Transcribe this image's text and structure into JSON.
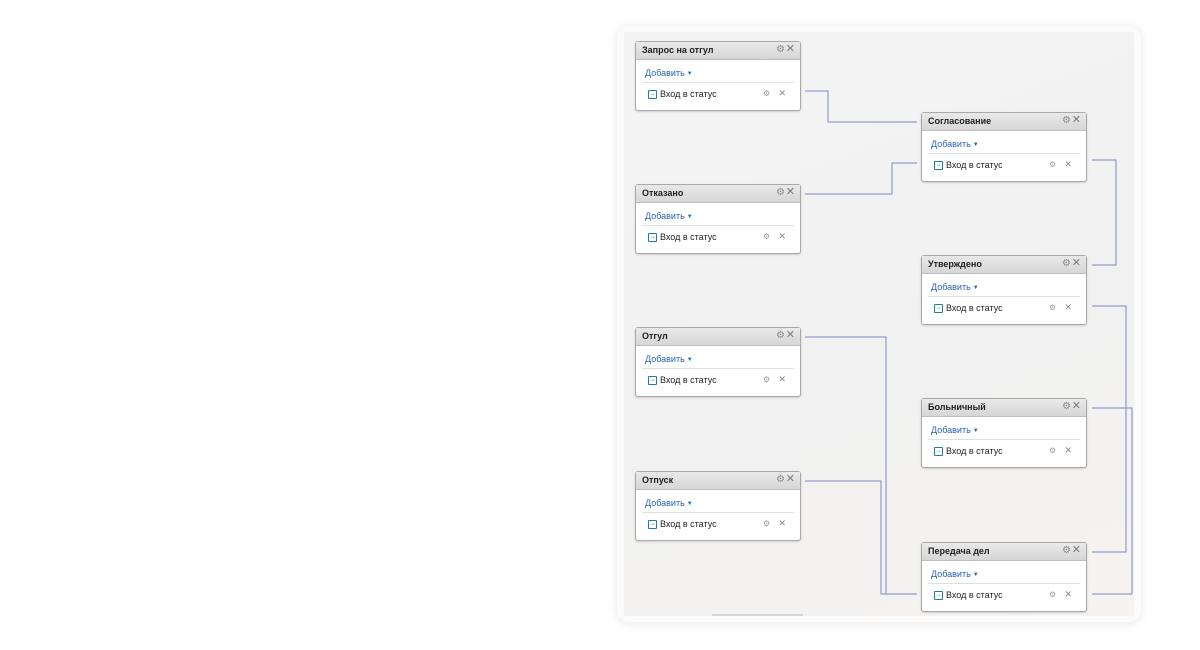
{
  "colors": {
    "connector": "#7c87c4",
    "link": "#2a64b0",
    "row_icon": "#1f7ea0"
  },
  "icons": {
    "settings": "gear-icon",
    "close": "close-icon",
    "row": "enter-status-icon",
    "caret": "caret-down-icon"
  },
  "nodes": [
    {
      "title": "Запрос на отгул",
      "add_label": "Добавить",
      "row_label": "Вход в статус"
    },
    {
      "title": "Отказано",
      "add_label": "Добавить",
      "row_label": "Вход в статус"
    },
    {
      "title": "Отгул",
      "add_label": "Добавить",
      "row_label": "Вход в статус"
    },
    {
      "title": "Отпуск",
      "add_label": "Добавить",
      "row_label": "Вход в статус"
    },
    {
      "title": "Согласование",
      "add_label": "Добавить",
      "row_label": "Вход в статус"
    },
    {
      "title": "Утверждено",
      "add_label": "Добавить",
      "row_label": "Вход в статус"
    },
    {
      "title": "Больничный",
      "add_label": "Добавить",
      "row_label": "Вход в статус"
    },
    {
      "title": "Передача дел",
      "add_label": "Добавить",
      "row_label": "Вход в статус"
    }
  ]
}
